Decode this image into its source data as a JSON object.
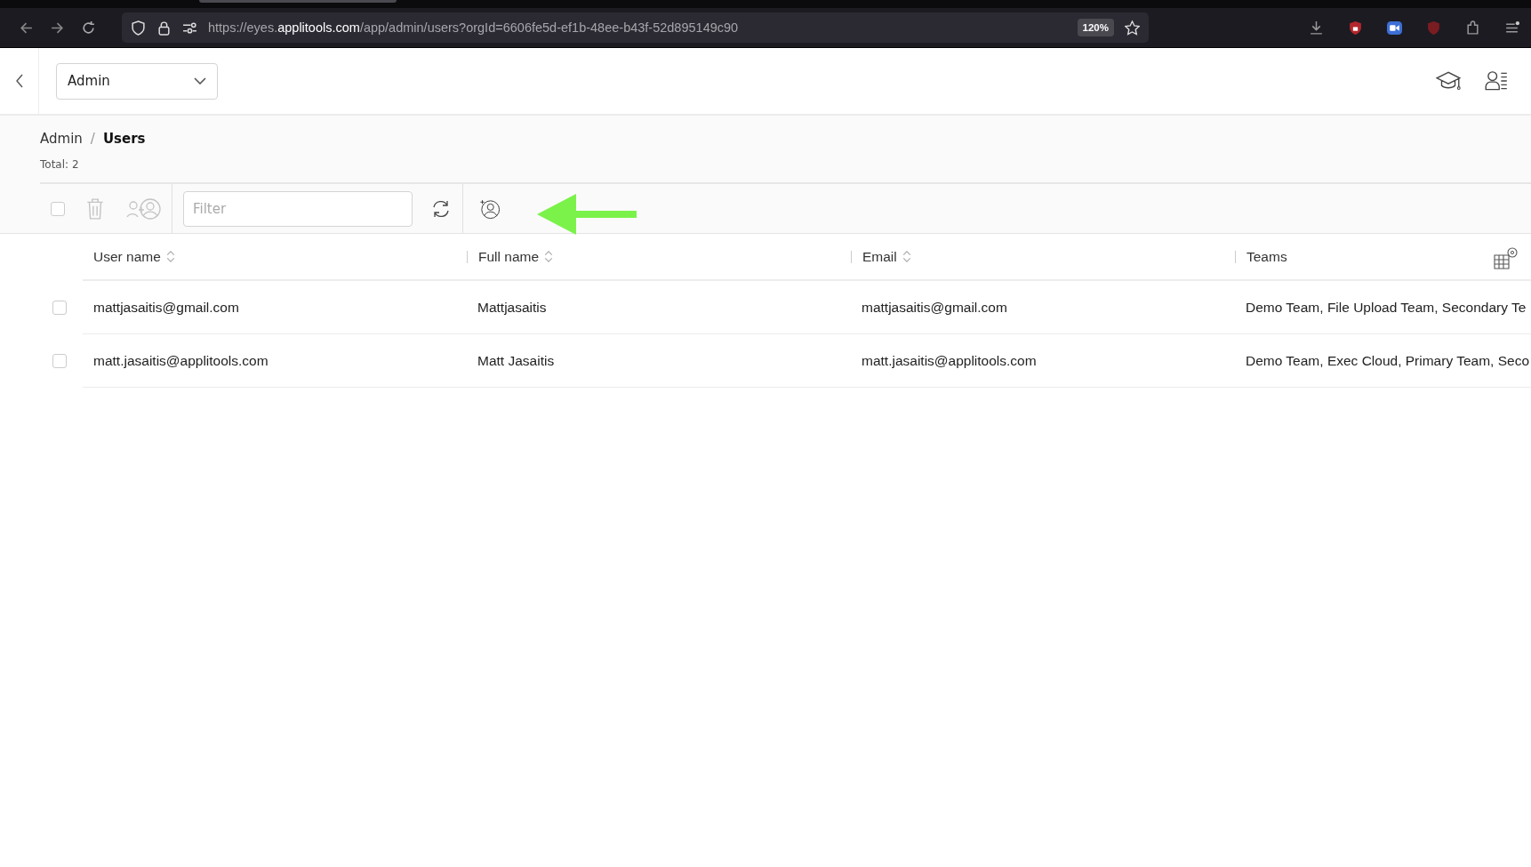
{
  "browser": {
    "url": "https://eyes.**applitools.com**/app/admin/users?orgId=6606fe5d-ef1b-48ee-b43f-52d895149c90",
    "zoom": "120%"
  },
  "header": {
    "section_dropdown": "Admin"
  },
  "breadcrumb": {
    "items": [
      "Admin",
      "Users"
    ],
    "separator": "/"
  },
  "total": "Total: 2",
  "toolbar": {
    "select_all_checked": false,
    "delete_disabled": true,
    "assign_disabled": true,
    "filter": {
      "placeholder": "Filter"
    }
  },
  "table": {
    "columns": [
      {
        "label": "User name",
        "sortable": true
      },
      {
        "label": "Full name",
        "sortable": true
      },
      {
        "label": "Email",
        "sortable": true
      },
      {
        "label": "Teams",
        "sortable": false
      }
    ],
    "rows": [
      {
        "checked": false,
        "cells": [
          "mattjasaitis@gmail.com",
          "Mattjasaitis",
          "mattjasaitis@gmail.com",
          "Demo Team, File Upload Team, Secondary Te"
        ]
      },
      {
        "checked": false,
        "cells": [
          "matt.jasaitis@applitools.com",
          "Matt Jasaitis",
          "matt.jasaitis@applitools.com",
          "Demo Team, Exec Cloud, Primary Team, Seco"
        ]
      }
    ]
  }
}
